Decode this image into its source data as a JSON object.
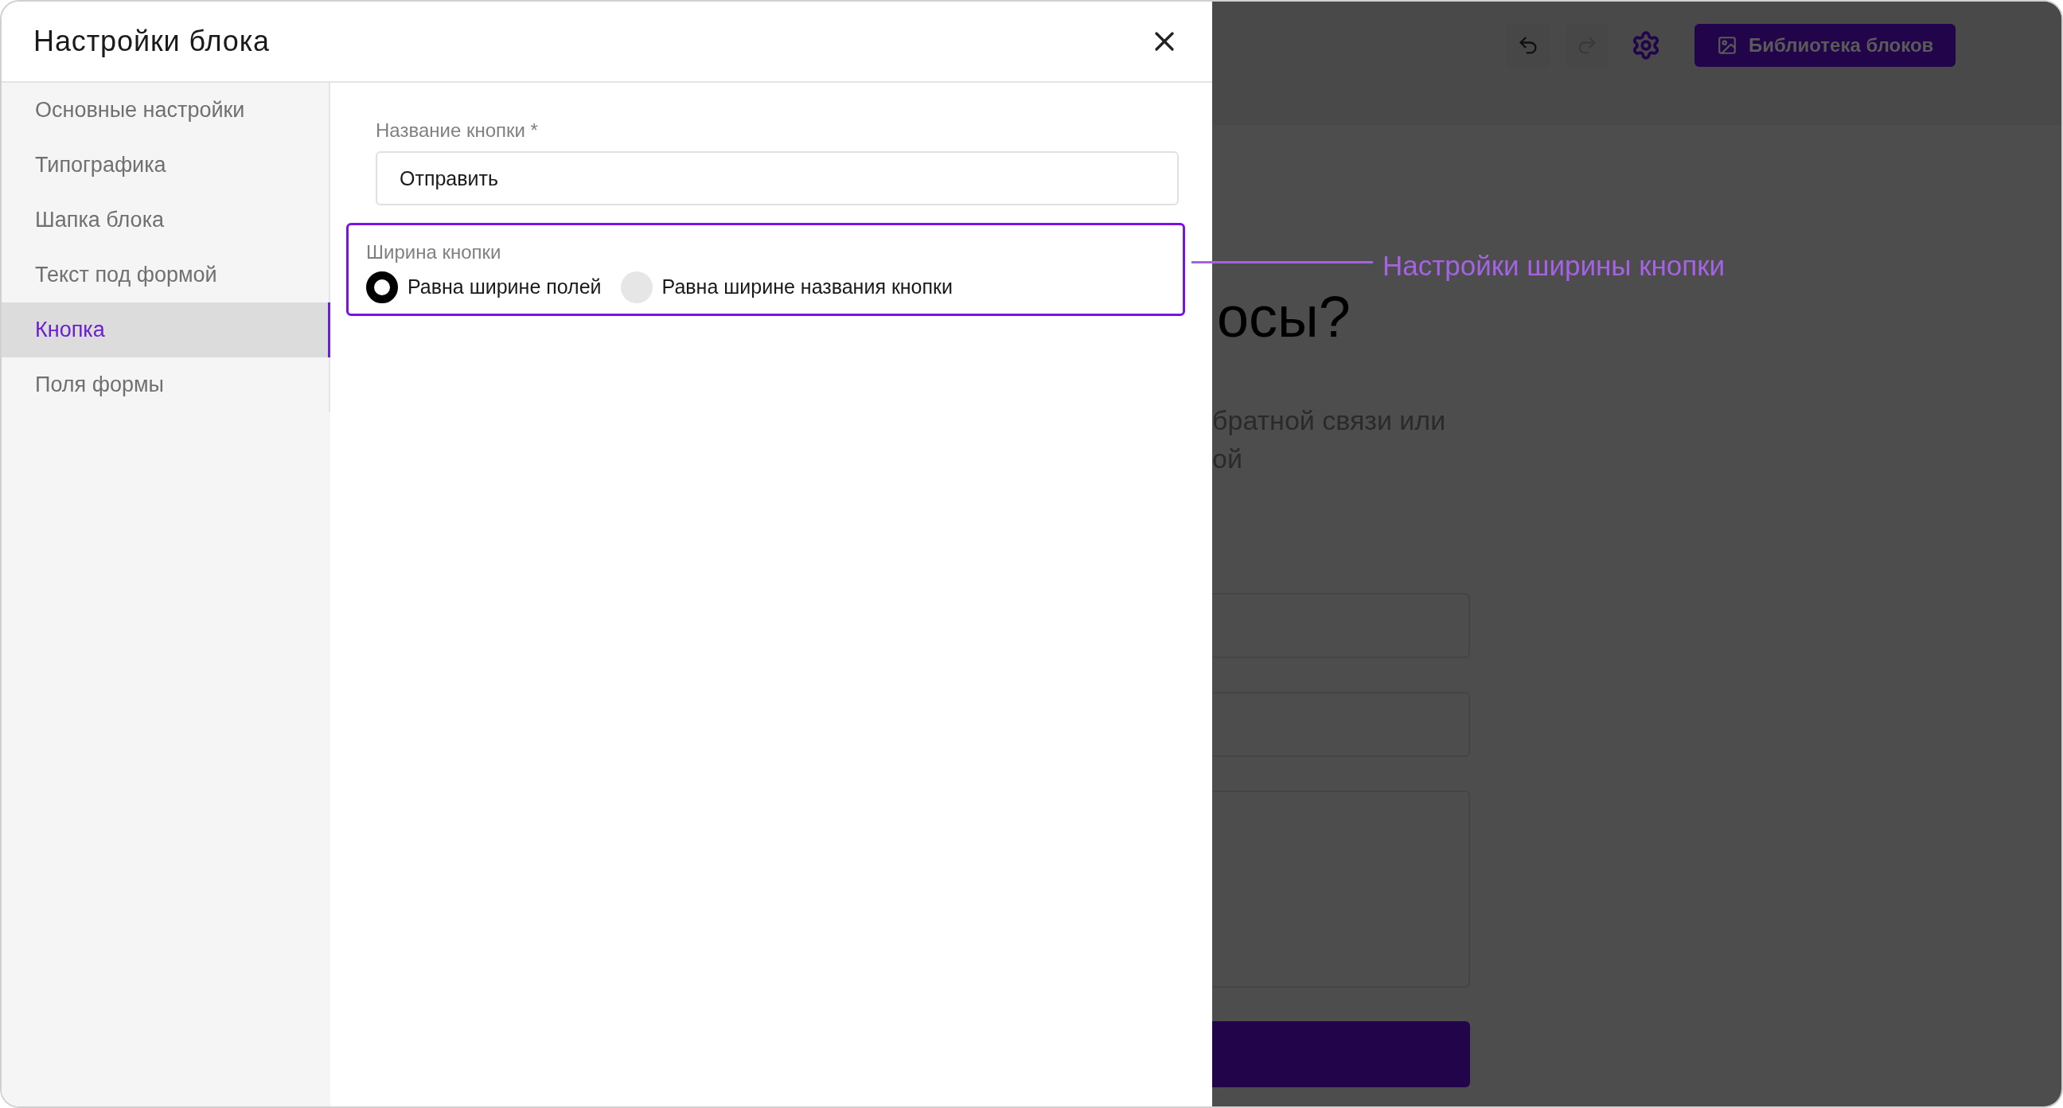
{
  "modal": {
    "title": "Настройки блока",
    "sidebar": {
      "items": [
        {
          "label": "Основные настройки",
          "selected": false
        },
        {
          "label": "Типографика",
          "selected": false
        },
        {
          "label": "Шапка блока",
          "selected": false
        },
        {
          "label": "Текст под формой",
          "selected": false
        },
        {
          "label": "Кнопка",
          "selected": true
        },
        {
          "label": "Поля формы",
          "selected": false
        }
      ]
    },
    "name_field": {
      "label": "Название кнопки *",
      "value": "Отправить"
    },
    "width_group": {
      "label": "Ширина кнопки",
      "highlighted": true,
      "options": [
        {
          "label": "Равна ширине полей",
          "selected": true
        },
        {
          "label": "Равна ширине названия кнопки",
          "selected": false
        }
      ]
    }
  },
  "background_app": {
    "toolbar": {
      "undo": {
        "disabled": false
      },
      "redo": {
        "disabled": true
      },
      "library_button": "Библиотека блоков"
    },
    "heading": "осы?",
    "text_lines": [
      "братной связи или",
      "ой"
    ],
    "form_parts": [
      {
        "kind": "input"
      },
      {
        "kind": "input"
      },
      {
        "kind": "textarea"
      },
      {
        "kind": "button"
      }
    ]
  },
  "annotation": {
    "text": "Настройки ширины кнопки"
  }
}
